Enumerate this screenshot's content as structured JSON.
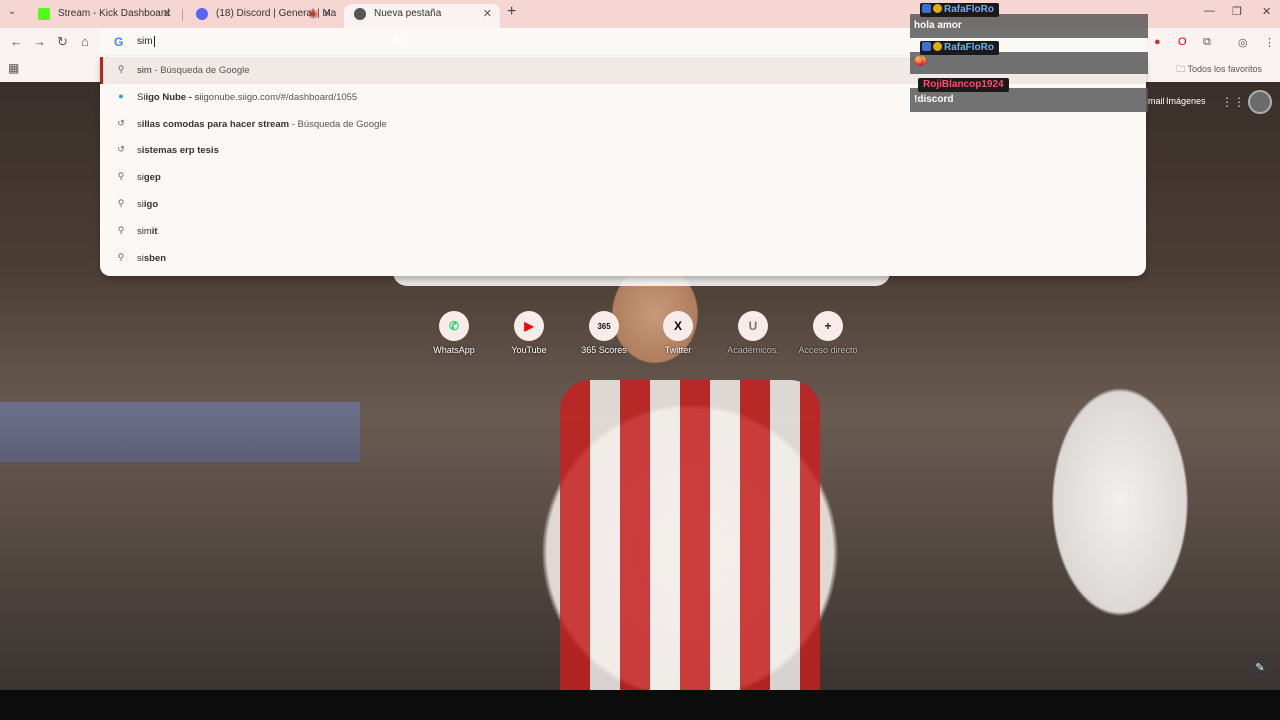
{
  "browser": {
    "tabs": [
      {
        "title": "Stream - Kick Dashboard",
        "favicon_color": "#53fc18"
      },
      {
        "title": "(18) Discord | General | Ma",
        "favicon_color": "#5865f2"
      },
      {
        "title": "Nueva pestaña",
        "favicon_color": "#555555"
      }
    ],
    "omnibox": {
      "value": "sim"
    },
    "bookmarks": {
      "all_favorites": "Todos los favoritos"
    }
  },
  "suggestions": [
    {
      "icon": "search-icon",
      "parts": [
        {
          "t": "sim",
          "b": false
        },
        {
          "t": " - Búsqueda de Google",
          "sub": true
        }
      ]
    },
    {
      "icon": "siigo-icon",
      "parts": [
        {
          "t": "Si",
          "b": false
        },
        {
          "t": "igo Nube - ",
          "b": true
        },
        {
          "t": "si",
          "b": false
        },
        {
          "t": "igonube.siigo.com/#/dashboard/1055",
          "sub": true
        }
      ]
    },
    {
      "icon": "history-icon",
      "parts": [
        {
          "t": "s",
          "b": false
        },
        {
          "t": "illas comodas para hacer stream",
          "b": true
        },
        {
          "t": " - Búsqueda de Google",
          "sub": true
        }
      ]
    },
    {
      "icon": "history-icon",
      "parts": [
        {
          "t": "s",
          "b": false
        },
        {
          "t": "istemas erp tesis",
          "b": true
        }
      ]
    },
    {
      "icon": "search-icon",
      "parts": [
        {
          "t": "si",
          "b": false
        },
        {
          "t": "gep",
          "b": true
        }
      ]
    },
    {
      "icon": "search-icon",
      "parts": [
        {
          "t": "si",
          "b": false
        },
        {
          "t": "igo",
          "b": true
        }
      ]
    },
    {
      "icon": "search-icon",
      "parts": [
        {
          "t": "sim",
          "b": false
        },
        {
          "t": "it",
          "b": true
        }
      ]
    },
    {
      "icon": "search-icon",
      "parts": [
        {
          "t": "si",
          "b": false
        },
        {
          "t": "sben",
          "b": true
        }
      ]
    }
  ],
  "newtab": {
    "header": {
      "gmail": "Gmail",
      "images": "Imágenes"
    },
    "shortcuts": [
      {
        "label": "WhatsApp",
        "icon": "whatsapp-icon",
        "glyph": "✆",
        "color": "#25d366"
      },
      {
        "label": "YouTube",
        "icon": "youtube-icon",
        "glyph": "▶",
        "color": "#ff0000"
      },
      {
        "label": "365 Scores",
        "icon": "365scores-icon",
        "glyph": "365",
        "color": "#111111"
      },
      {
        "label": "Twitter",
        "icon": "x-icon",
        "glyph": "X",
        "color": "#000000"
      },
      {
        "label": "Académicos.",
        "icon": "academic-icon",
        "glyph": "U",
        "color": "#777777"
      },
      {
        "label": "Acceso directo",
        "icon": "add-icon",
        "glyph": "+",
        "color": "#222222"
      }
    ]
  },
  "chat": [
    {
      "user": "RafaFloRo",
      "user_color": "#6ab0ff",
      "text": "hola amor"
    },
    {
      "user": "RafaFloRo",
      "user_color": "#6ab0ff",
      "text": "🍑"
    },
    {
      "user": "RojiBlancop1924",
      "user_color": "#ff4d6d",
      "text": "!discord"
    }
  ],
  "colors": {
    "accent": "#b3261e",
    "tabstrip": "#f6d6d2",
    "toolbar": "#fbf3f1"
  }
}
